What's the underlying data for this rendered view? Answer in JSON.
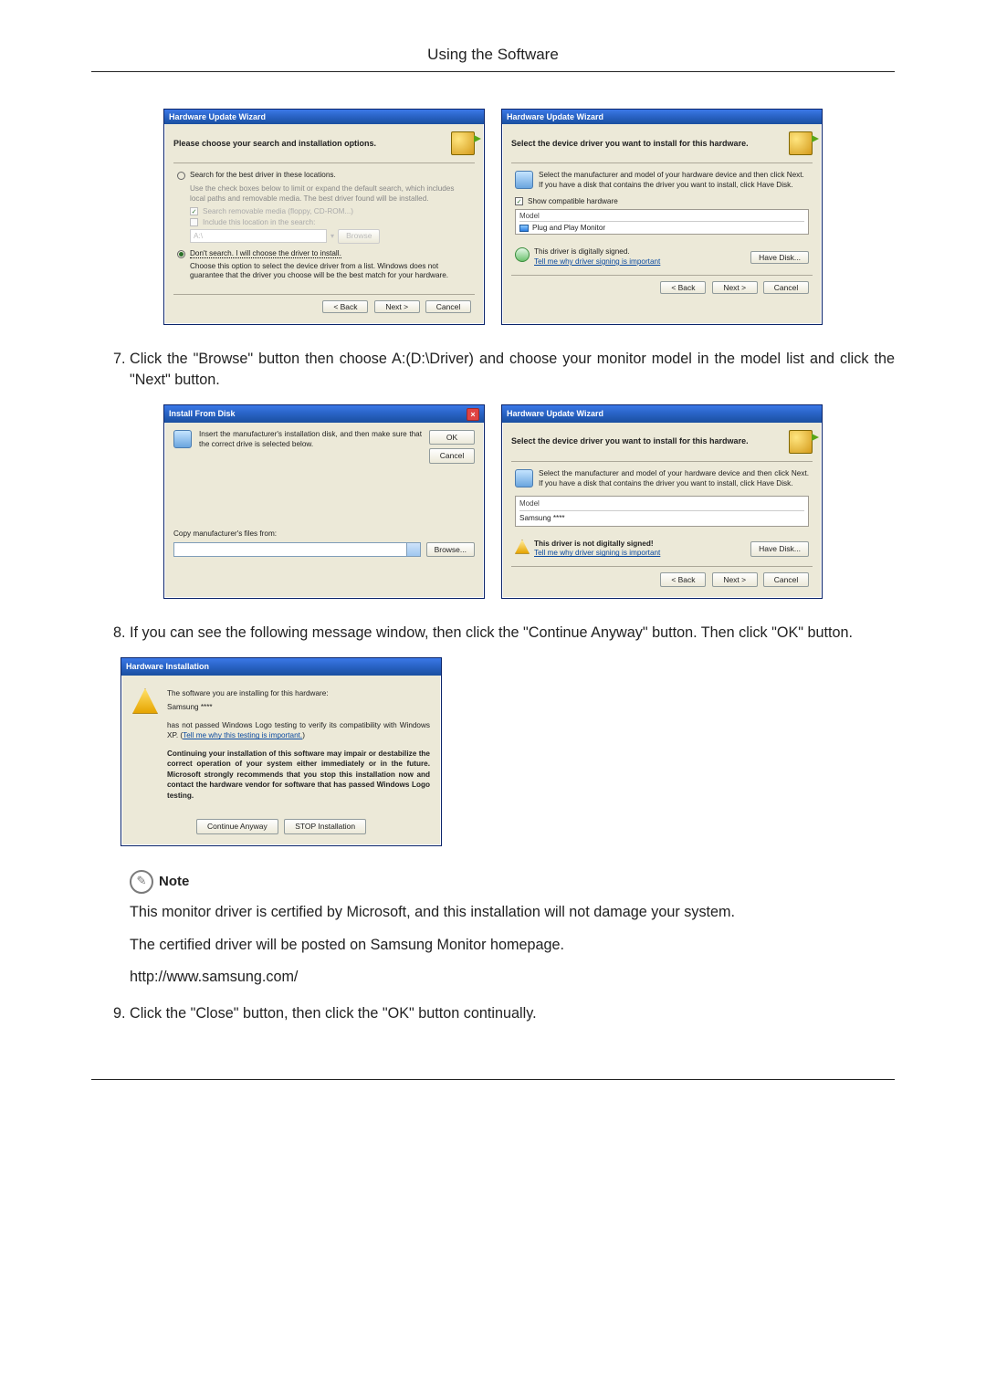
{
  "page": {
    "header": "Using the Software"
  },
  "steps": {
    "s7": "Click the \"Browse\" button then choose A:(D:\\Driver) and choose your monitor model in the model list and click the \"Next\" button.",
    "s8": "If you can see the following message window, then click the \"Continue Anyway\" button. Then click \"OK\" button.",
    "s9": "Click the \"Close\" button, then click the \"OK\" button continually."
  },
  "dlg_search": {
    "title": "Hardware Update Wizard",
    "heading": "Please choose your search and installation options.",
    "opt1": "Search for the best driver in these locations.",
    "opt1_desc": "Use the check boxes below to limit or expand the default search, which includes local paths and removable media. The best driver found will be installed.",
    "chk1": "Search removable media (floppy, CD-ROM...)",
    "chk2": "Include this location in the search:",
    "path_placeholder": "A:\\",
    "browse_btn": "Browse",
    "opt2": "Don't search. I will choose the driver to install.",
    "opt2_desc": "Choose this option to select the device driver from a list. Windows does not guarantee that the driver you choose will be the best match for your hardware.",
    "back": "< Back",
    "next": "Next >",
    "cancel": "Cancel"
  },
  "dlg_select": {
    "title": "Hardware Update Wizard",
    "heading": "Select the device driver you want to install for this hardware.",
    "instr": "Select the manufacturer and model of your hardware device and then click Next. If you have a disk that contains the driver you want to install, click Have Disk.",
    "show_compat": "Show compatible hardware",
    "model_hdr": "Model",
    "model_item": "Plug and Play Monitor",
    "signed": "This driver is digitally signed.",
    "signing_link": "Tell me why driver signing is important",
    "have_disk": "Have Disk...",
    "back": "< Back",
    "next": "Next >",
    "cancel": "Cancel"
  },
  "dlg_install_from_disk": {
    "title": "Install From Disk",
    "msg": "Insert the manufacturer's installation disk, and then make sure that the correct drive is selected below.",
    "ok": "OK",
    "cancel": "Cancel",
    "copy_label": "Copy manufacturer's files from:",
    "browse": "Browse..."
  },
  "dlg_select2": {
    "title": "Hardware Update Wizard",
    "heading": "Select the device driver you want to install for this hardware.",
    "instr": "Select the manufacturer and model of your hardware device and then click Next. If you have a disk that contains the driver you want to install, click Have Disk.",
    "model_hdr": "Model",
    "model_item": "Samsung ****",
    "unsigned": "This driver is not digitally signed!",
    "signing_link": "Tell me why driver signing is important",
    "have_disk": "Have Disk...",
    "back": "< Back",
    "next": "Next >",
    "cancel": "Cancel"
  },
  "dlg_hwinst": {
    "title": "Hardware Installation",
    "line1": "The software you are installing for this hardware:",
    "device": "Samsung ****",
    "line2a": "has not passed Windows Logo testing to verify its compatibility with Windows XP. (",
    "line2_link": "Tell me why this testing is important.",
    "line2b": ")",
    "bold_msg": "Continuing your installation of this software may impair or destabilize the correct operation of your system either immediately or in the future. Microsoft strongly recommends that you stop this installation now and contact the hardware vendor for software that has passed Windows Logo testing.",
    "continue": "Continue Anyway",
    "stop": "STOP Installation"
  },
  "note": {
    "label": "Note",
    "p1": "This monitor driver is certified by Microsoft, and this installation will not damage your system.",
    "p2": "The certified driver will be posted on Samsung Monitor homepage.",
    "url": "http://www.samsung.com/"
  }
}
